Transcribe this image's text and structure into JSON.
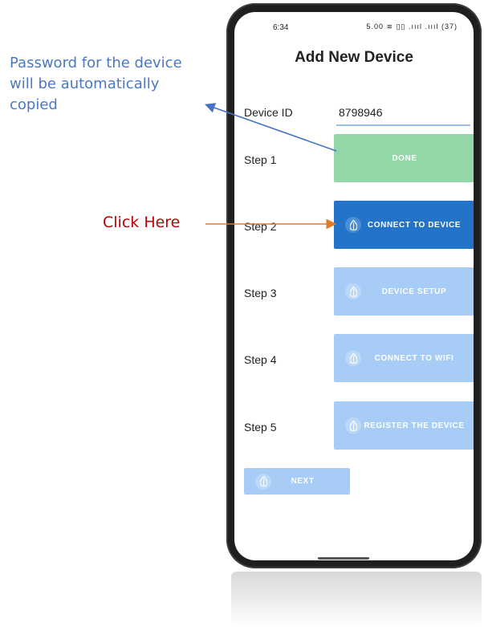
{
  "annotations": {
    "password_note": "Password for the device will be automatically copied",
    "click_here": "Click Here"
  },
  "status_bar": {
    "time": "6:34",
    "icons_text": "5.00 ≋ ▯▯ .ıııl .ıııl (37)"
  },
  "screen": {
    "title": "Add New Device",
    "device_id_label": "Device ID",
    "device_id_value": "8798946",
    "steps": [
      {
        "label": "Step 1",
        "button": "DONE",
        "state": "done"
      },
      {
        "label": "Step 2",
        "button": "CONNECT TO DEVICE",
        "state": "active"
      },
      {
        "label": "Step 3",
        "button": "DEVICE SETUP",
        "state": "disabled"
      },
      {
        "label": "Step 4",
        "button": "CONNECT TO WIFI",
        "state": "disabled"
      },
      {
        "label": "Step 5",
        "button": "REGISTER THE DEVICE",
        "state": "disabled"
      }
    ],
    "next_button": "NEXT"
  },
  "colors": {
    "done": "#93d7a8",
    "active": "#2273c9",
    "disabled": "#a7cdf6",
    "annotation_blue": "#4a78c2",
    "annotation_red": "#c00000",
    "arrow_orange": "#e07b2a"
  },
  "icons": [
    "water-drop-icon",
    "wifi-icon",
    "signal-icon",
    "battery-icon"
  ]
}
